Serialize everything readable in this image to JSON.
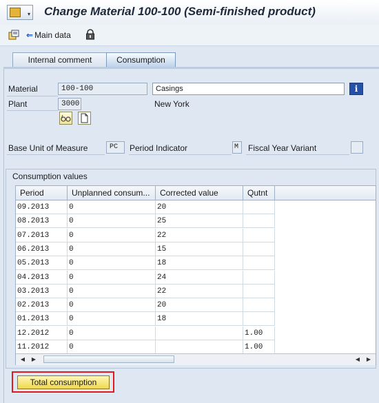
{
  "window": {
    "title": "Change Material 100-100 (Semi-finished product)"
  },
  "toolbar": {
    "main_data_label": "Main data"
  },
  "tabs": [
    {
      "label": "Internal comment",
      "active": false
    },
    {
      "label": "Consumption",
      "active": true
    }
  ],
  "header_fields": {
    "material_label": "Material",
    "material_value": "100-100",
    "material_desc": "Casings",
    "plant_label": "Plant",
    "plant_value": "3000",
    "plant_desc": "New York"
  },
  "unit_fields": {
    "base_uom_label": "Base Unit of Measure",
    "base_uom_value": "PC",
    "period_indicator_label": "Period Indicator",
    "period_indicator_value": "M",
    "fy_variant_label": "Fiscal Year Variant",
    "fy_variant_value": ""
  },
  "consumption": {
    "group_title": "Consumption values",
    "columns": [
      "Period",
      "Unplanned consum...",
      "Corrected value",
      "Qutnt"
    ],
    "rows": [
      [
        "09.2013",
        "0",
        "20",
        ""
      ],
      [
        "08.2013",
        "0",
        "25",
        ""
      ],
      [
        "07.2013",
        "0",
        "22",
        ""
      ],
      [
        "06.2013",
        "0",
        "15",
        ""
      ],
      [
        "05.2013",
        "0",
        "18",
        ""
      ],
      [
        "04.2013",
        "0",
        "24",
        ""
      ],
      [
        "03.2013",
        "0",
        "22",
        ""
      ],
      [
        "02.2013",
        "0",
        "20",
        ""
      ],
      [
        "01.2013",
        "0",
        "18",
        ""
      ],
      [
        "12.2012",
        "0",
        "",
        "1.00"
      ],
      [
        "11.2012",
        "0",
        "",
        "1.00"
      ]
    ]
  },
  "buttons": {
    "total_consumption": "Total consumption"
  },
  "colors": {
    "highlight": "#e01b1b",
    "button_yellow": "#f0d94a",
    "background": "#dfe8f2"
  }
}
